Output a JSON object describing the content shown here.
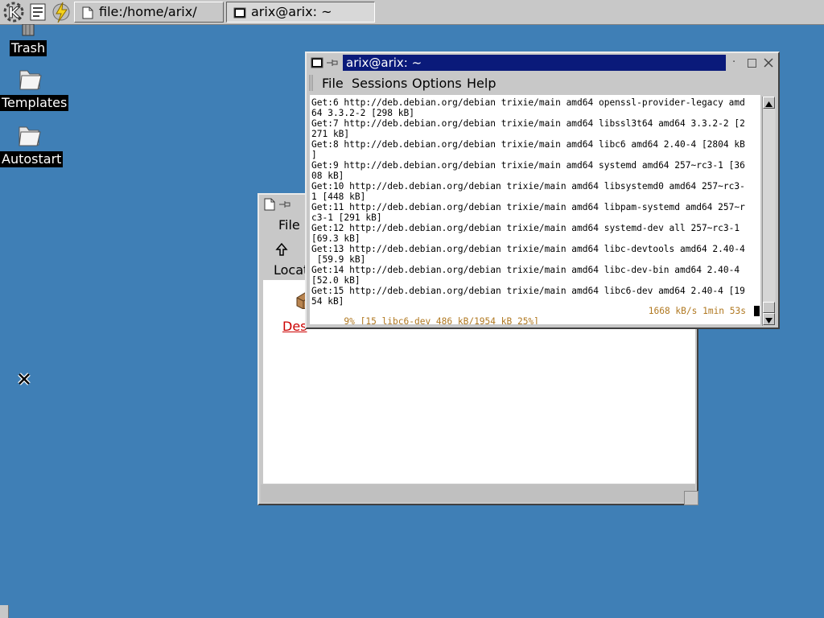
{
  "taskbar": {
    "tasks": [
      {
        "label": "file:/home/arix/"
      },
      {
        "label": "arix@arix: ~"
      }
    ]
  },
  "desktop": {
    "icons": [
      {
        "label": "Trash"
      },
      {
        "label": "Templates"
      },
      {
        "label": "Autostart"
      }
    ]
  },
  "filemanager": {
    "menu_file": "File",
    "location_label": "Locat",
    "item_label": "Des"
  },
  "terminal": {
    "title": "arix@arix: ~",
    "menu": [
      "File",
      "Sessions",
      "Options",
      "Help"
    ],
    "lines": [
      "Get:6 http://deb.debian.org/debian trixie/main amd64 openssl-provider-legacy amd",
      "64 3.3.2-2 [298 kB]",
      "Get:7 http://deb.debian.org/debian trixie/main amd64 libssl3t64 amd64 3.3.2-2 [2",
      "271 kB]",
      "Get:8 http://deb.debian.org/debian trixie/main amd64 libc6 amd64 2.40-4 [2804 kB",
      "]",
      "Get:9 http://deb.debian.org/debian trixie/main amd64 systemd amd64 257~rc3-1 [36",
      "08 kB]",
      "Get:10 http://deb.debian.org/debian trixie/main amd64 libsystemd0 amd64 257~rc3-",
      "1 [448 kB]",
      "Get:11 http://deb.debian.org/debian trixie/main amd64 libpam-systemd amd64 257~r",
      "c3-1 [291 kB]",
      "Get:12 http://deb.debian.org/debian trixie/main amd64 systemd-dev all 257~rc3-1",
      "[69.3 kB]",
      "Get:13 http://deb.debian.org/debian trixie/main amd64 libc-devtools amd64 2.40-4",
      " [59.9 kB]",
      "Get:14 http://deb.debian.org/debian trixie/main amd64 libc-dev-bin amd64 2.40-4",
      "[52.0 kB]",
      "Get:15 http://deb.debian.org/debian trixie/main amd64 libc6-dev amd64 2.40-4 [19",
      "54 kB]"
    ],
    "status_left": "9% [15 libc6-dev 486 kB/1954 kB 25%]",
    "status_right": "1668 kB/s 1min 53s"
  },
  "colors": {
    "desktop_bg": "#3f7fb6",
    "active_title": "#0a1a7a",
    "status_text": "#b07820",
    "link_red": "#cc0000"
  }
}
